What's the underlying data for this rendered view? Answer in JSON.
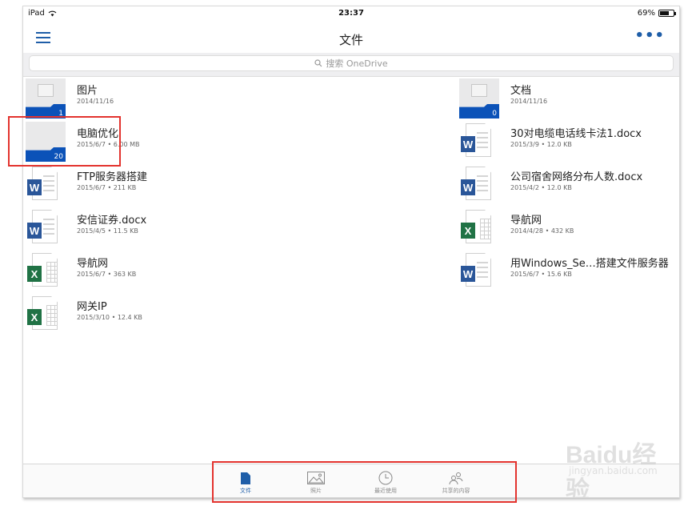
{
  "status_bar": {
    "device": "iPad",
    "time": "23:37",
    "battery": "69%",
    "battery_level": 0.69
  },
  "nav": {
    "title": "文件"
  },
  "search": {
    "placeholder": "搜索 OneDrive"
  },
  "items": [
    {
      "name": "图片",
      "meta": "2014/11/16",
      "type": "folder",
      "count": "1",
      "icon": "photos-folder-icon"
    },
    {
      "name": "文档",
      "meta": "2014/11/16",
      "type": "folder",
      "count": "0",
      "icon": "documents-folder-icon"
    },
    {
      "name": "电脑优化",
      "meta": "2015/6/7 • 6.00 MB",
      "type": "folder",
      "count": "20",
      "icon": "folder-icon"
    },
    {
      "name": "30对电缆电话线卡法1.docx",
      "meta": "2015/3/9 • 12.0 KB",
      "type": "word",
      "icon": "word-doc-icon"
    },
    {
      "name": "FTP服务器搭建",
      "meta": "2015/6/7 • 211 KB",
      "type": "word",
      "icon": "word-doc-icon"
    },
    {
      "name": "公司宿舍网络分布人数.docx",
      "meta": "2015/4/2 • 12.0 KB",
      "type": "word",
      "icon": "word-doc-icon"
    },
    {
      "name": "安信证券.docx",
      "meta": "2015/4/5 • 11.5 KB",
      "type": "word",
      "icon": "word-doc-icon"
    },
    {
      "name": "导航网",
      "meta": "2014/4/28 • 432 KB",
      "type": "excel",
      "icon": "excel-doc-icon"
    },
    {
      "name": "导航网",
      "meta": "2015/6/7 • 363 KB",
      "type": "excel",
      "icon": "excel-doc-icon"
    },
    {
      "name": "用Windows_Se…搭建文件服务器",
      "meta": "2015/6/7 • 15.6 KB",
      "type": "word",
      "icon": "word-doc-icon"
    },
    {
      "name": "网关IP",
      "meta": "2015/3/10 • 12.4 KB",
      "type": "excel",
      "icon": "excel-doc-icon"
    }
  ],
  "tabs": [
    {
      "label": "文件",
      "icon": "file-icon",
      "active": true
    },
    {
      "label": "照片",
      "icon": "photo-icon",
      "active": false
    },
    {
      "label": "最近使用",
      "icon": "clock-icon",
      "active": false
    },
    {
      "label": "共享的内容",
      "icon": "people-icon",
      "active": false
    }
  ],
  "watermark": {
    "line1": "Baidu经验",
    "line2": "jingyan.baidu.com"
  },
  "colors": {
    "accent": "#1f5ea8",
    "folder_blue": "#0b52b8",
    "word": "#2a5699",
    "excel": "#207245",
    "highlight": "#e3332e"
  }
}
